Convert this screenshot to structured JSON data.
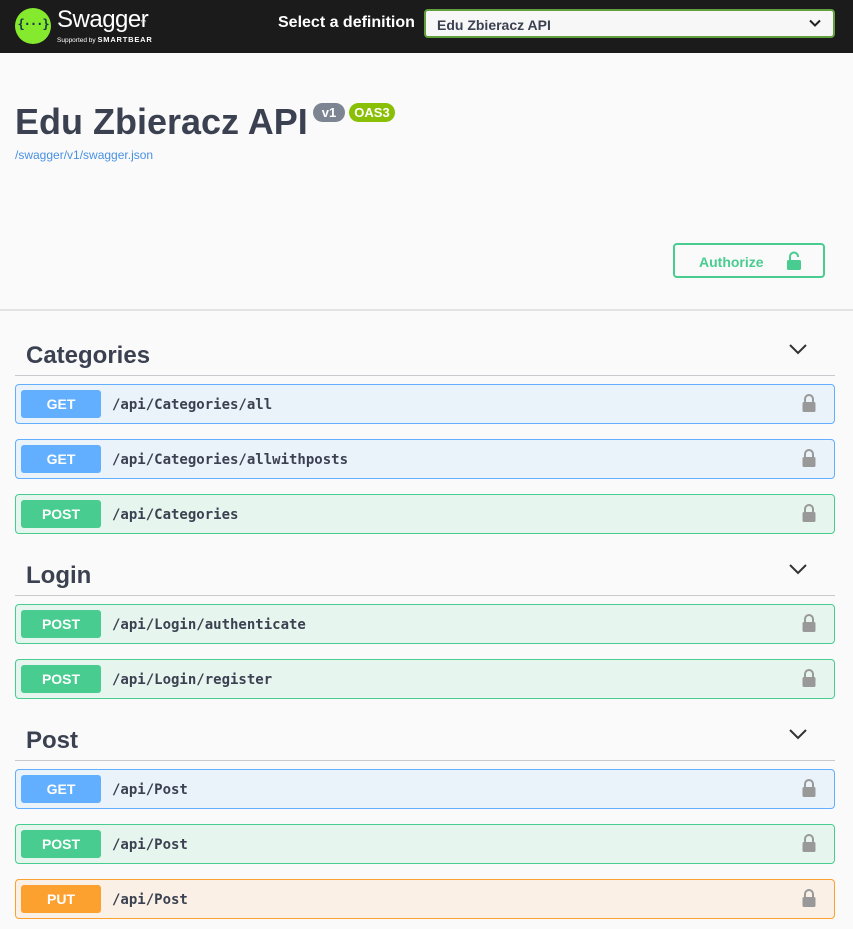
{
  "topbar": {
    "logo_name": "Swagger",
    "logo_tm": "™",
    "logo_supported": "Supported by",
    "logo_brand": "SMARTBEAR",
    "logo_glyph": "{···}",
    "definition_label": "Select a definition",
    "definition_selected": "Edu Zbieracz API"
  },
  "info": {
    "title": "Edu Zbieracz API",
    "version": "v1",
    "oas": "OAS3",
    "url": "/swagger/v1/swagger.json"
  },
  "authorize": {
    "label": "Authorize",
    "icon": "unlocked-padlock-icon"
  },
  "colors": {
    "get": "#61affe",
    "post": "#49cc90",
    "put": "#fca130",
    "topbar": "#1b1b1b",
    "logo": "#85ea2d"
  },
  "tags": [
    {
      "name": "Categories",
      "operations": [
        {
          "method": "GET",
          "path": "/api/Categories/all"
        },
        {
          "method": "GET",
          "path": "/api/Categories/allwithposts"
        },
        {
          "method": "POST",
          "path": "/api/Categories"
        }
      ]
    },
    {
      "name": "Login",
      "operations": [
        {
          "method": "POST",
          "path": "/api/Login/authenticate"
        },
        {
          "method": "POST",
          "path": "/api/Login/register"
        }
      ]
    },
    {
      "name": "Post",
      "operations": [
        {
          "method": "GET",
          "path": "/api/Post"
        },
        {
          "method": "POST",
          "path": "/api/Post"
        },
        {
          "method": "PUT",
          "path": "/api/Post"
        }
      ]
    }
  ]
}
